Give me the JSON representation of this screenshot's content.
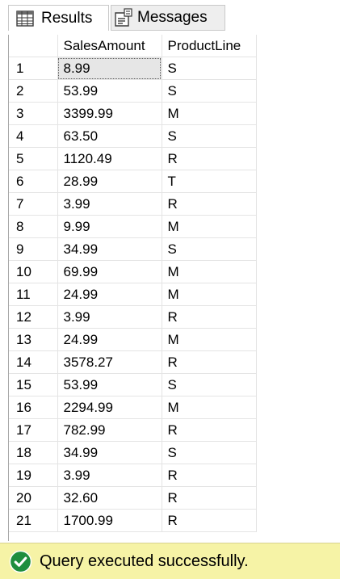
{
  "tabs": {
    "results_label": "Results",
    "messages_label": "Messages",
    "results_icon": "grid-icon",
    "messages_icon": "messages-icon"
  },
  "grid": {
    "columns": [
      "SalesAmount",
      "ProductLine"
    ],
    "rows": [
      {
        "n": "1",
        "amount": "8.99",
        "line": "S"
      },
      {
        "n": "2",
        "amount": "53.99",
        "line": "S"
      },
      {
        "n": "3",
        "amount": "3399.99",
        "line": "M"
      },
      {
        "n": "4",
        "amount": "63.50",
        "line": "S"
      },
      {
        "n": "5",
        "amount": "1120.49",
        "line": "R"
      },
      {
        "n": "6",
        "amount": "28.99",
        "line": "T"
      },
      {
        "n": "7",
        "amount": "3.99",
        "line": "R"
      },
      {
        "n": "8",
        "amount": "9.99",
        "line": "M"
      },
      {
        "n": "9",
        "amount": "34.99",
        "line": "S"
      },
      {
        "n": "10",
        "amount": "69.99",
        "line": "M"
      },
      {
        "n": "11",
        "amount": "24.99",
        "line": "M"
      },
      {
        "n": "12",
        "amount": "3.99",
        "line": "R"
      },
      {
        "n": "13",
        "amount": "24.99",
        "line": "M"
      },
      {
        "n": "14",
        "amount": "3578.27",
        "line": "R"
      },
      {
        "n": "15",
        "amount": "53.99",
        "line": "S"
      },
      {
        "n": "16",
        "amount": "2294.99",
        "line": "M"
      },
      {
        "n": "17",
        "amount": "782.99",
        "line": "R"
      },
      {
        "n": "18",
        "amount": "34.99",
        "line": "S"
      },
      {
        "n": "19",
        "amount": "3.99",
        "line": "R"
      },
      {
        "n": "20",
        "amount": "32.60",
        "line": "R"
      },
      {
        "n": "21",
        "amount": "1700.99",
        "line": "R"
      }
    ],
    "selected_cell": {
      "row": 0,
      "column": "SalesAmount"
    }
  },
  "status": {
    "message": "Query executed successfully.",
    "icon": "check-circle-icon",
    "color": "#f6f3a6",
    "icon_color": "#1e8e3e"
  }
}
